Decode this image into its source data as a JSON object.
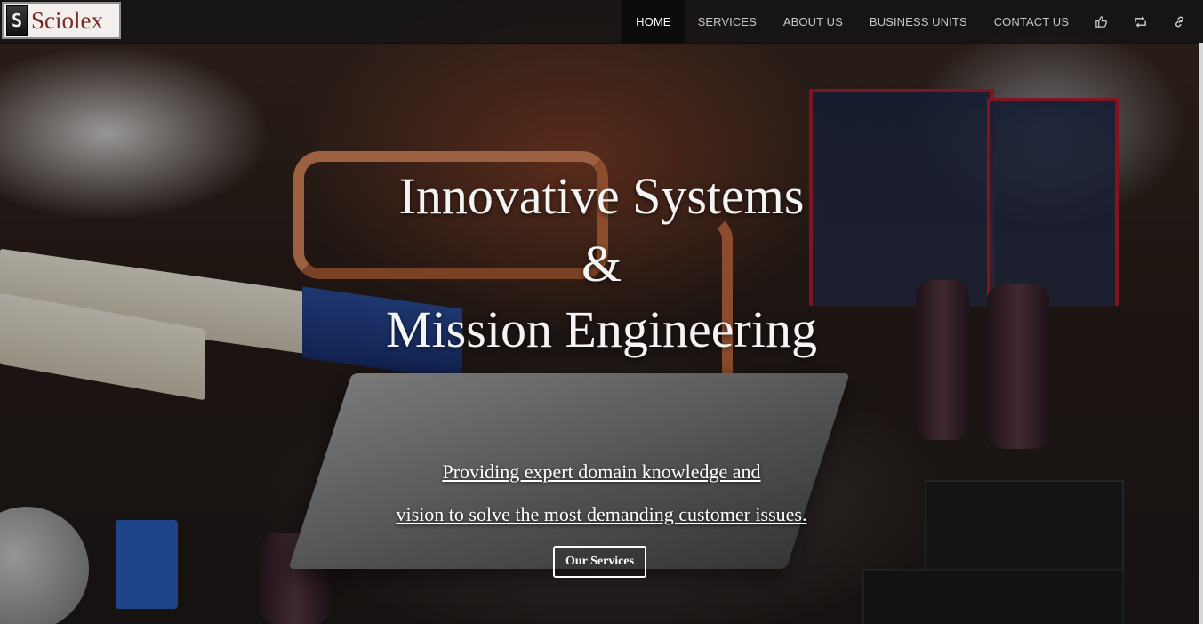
{
  "brand": {
    "logo_mark": "S",
    "name": "Sciolex"
  },
  "nav": {
    "items": [
      {
        "label": "HOME",
        "active": true
      },
      {
        "label": "SERVICES"
      },
      {
        "label": "ABOUT US"
      },
      {
        "label": "BUSINESS UNITS"
      },
      {
        "label": "CONTACT US"
      }
    ],
    "icons": [
      {
        "name": "thumbs-up-icon",
        "glyph": "👍"
      },
      {
        "name": "retweet-icon",
        "glyph": "⇄"
      },
      {
        "name": "link-icon",
        "glyph": "🔗"
      }
    ]
  },
  "hero": {
    "headline_line1": "Innovative Systems",
    "headline_line2": "&",
    "headline_line3": "Mission Engineering",
    "tagline_line1": "Providing expert domain knowledge and ",
    "tagline_line2": "vision to solve the most demanding customer issues.",
    "cta_label": "Our Services"
  },
  "colors": {
    "navbar_bg": "#141414",
    "active_nav_bg": "#0b0b0b",
    "logo_text": "#7a2a24"
  }
}
